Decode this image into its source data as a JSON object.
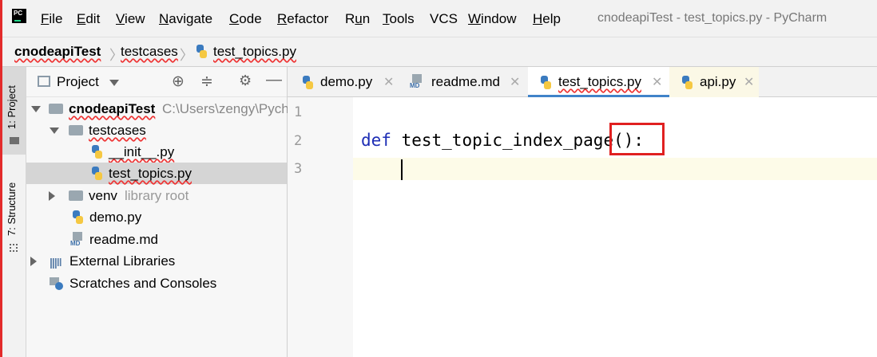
{
  "window": {
    "title": "cnodeapiTest - test_topics.py - PyCharm",
    "menu": [
      {
        "first": "F",
        "rest": "ile"
      },
      {
        "first": "E",
        "rest": "dit"
      },
      {
        "first": "V",
        "rest": "iew"
      },
      {
        "first": "N",
        "rest": "avigate"
      },
      {
        "first": "C",
        "rest": "ode"
      },
      {
        "first": "R",
        "rest": "efactor"
      },
      {
        "pre": "R",
        "first": "u",
        "rest": "n"
      },
      {
        "first": "T",
        "rest": "ools"
      },
      {
        "plain": "VCS"
      },
      {
        "first": "W",
        "rest": "indow"
      },
      {
        "first": "H",
        "rest": "elp"
      }
    ]
  },
  "breadcrumb": [
    "cnodeapiTest",
    "testcases",
    "test_topics.py"
  ],
  "toolstrip": {
    "project": "1: Project",
    "structure": "7: Structure"
  },
  "project_panel": {
    "header": "Project",
    "tree": [
      {
        "label": "cnodeapiTest",
        "hint": "C:\\Users\\zengy\\Pych"
      },
      {
        "label": "testcases"
      },
      {
        "label": "__init__.py"
      },
      {
        "label": "test_topics.py"
      },
      {
        "label": "venv",
        "hint": "library root"
      },
      {
        "label": "demo.py"
      },
      {
        "label": "readme.md"
      },
      {
        "label": "External Libraries"
      },
      {
        "label": "Scratches and Consoles"
      }
    ]
  },
  "tabs": [
    {
      "label": "demo.py"
    },
    {
      "label": "readme.md"
    },
    {
      "label": "test_topics.py"
    },
    {
      "label": "api.py"
    }
  ],
  "editor": {
    "line_numbers": [
      "1",
      "2",
      "3"
    ],
    "keyword": "def",
    "code_rest": " test_topic_index_page():"
  },
  "colors": {
    "accent": "#4083c9",
    "keyword": "#1d2db5",
    "highlight_box": "#e02020"
  }
}
